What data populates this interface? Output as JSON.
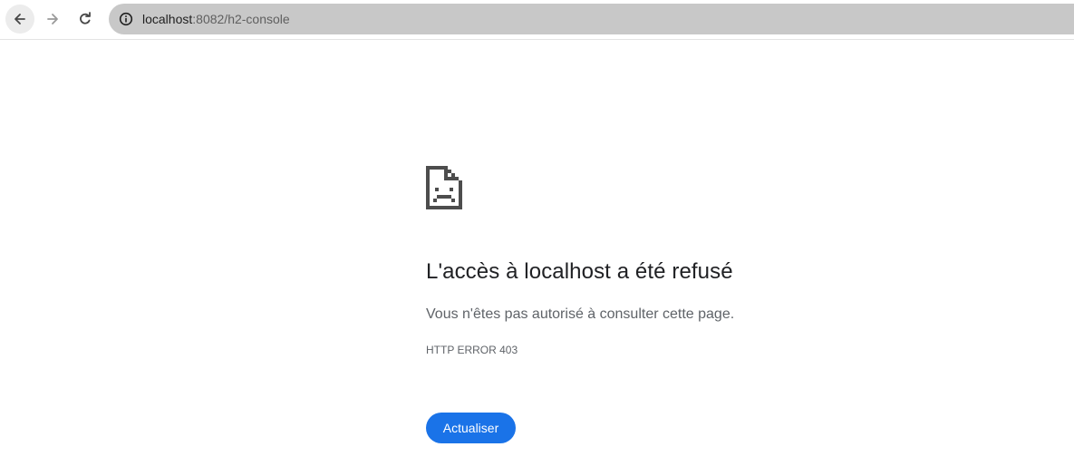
{
  "browser": {
    "url_host": "localhost",
    "url_path": ":8082/h2-console",
    "icons": {
      "back": "arrow-back-icon",
      "forward": "arrow-forward-icon",
      "reload": "reload-icon",
      "site_info": "info-icon"
    }
  },
  "error": {
    "icon": "sad-document-icon",
    "title": "L'accès à localhost a été refusé",
    "description": "Vous n'êtes pas autorisé à consulter cette page.",
    "code": "HTTP ERROR 403",
    "button_label": "Actualiser"
  },
  "colors": {
    "button": "#1a73e8",
    "omnibox": "#c8c8c8",
    "title": "#202124",
    "secondary_text": "#5f6368"
  }
}
